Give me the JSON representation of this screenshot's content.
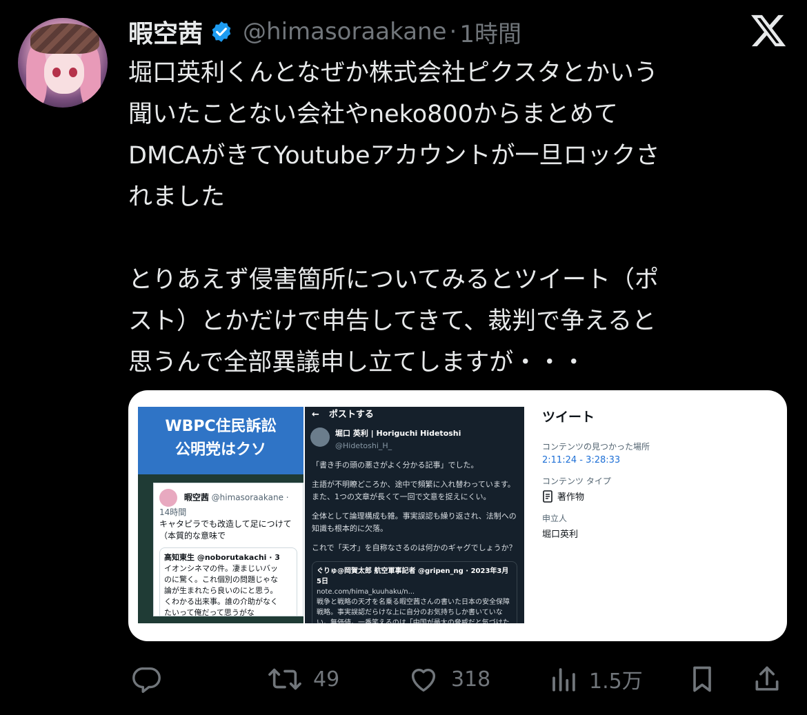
{
  "post": {
    "display_name": "暇空茜",
    "handle": "@himasoraakane",
    "separator": "·",
    "time": "1時間",
    "text": "堀口英利くんとなぜか株式会社ピクスタとかいう\n聞いたことない会社やneko800からまとめて\nDMCAがきてYoutubeアカウントが一旦ロックさ\nれました\n\nとりあえず侵害箇所についてみるとツイート（ポ\nスト）とかだけで申告してきて、裁判で争えると\n思うんで全部異議申し立てしますが・・・"
  },
  "card": {
    "screenshot_left": {
      "banner": "WBPC住民訴訟\n公明党はクソ",
      "tweet_name": "暇空茜",
      "tweet_handle": "@himasoraakane · 14時間",
      "tweet_text": "キャタピラでも改造して足につけて\n（本質的な意味で",
      "quote_author": "高知東生 @noborutakachi · 3",
      "quote_text": "イオンシネマの件。凄まじいバッ\nのに驚く。これ個別の問題じゃな\n論が生まれたら良いのにと思う。\nくわかる出来事。誰の介助がなく\nたいって俺だって思うがな"
    },
    "screenshot_right": {
      "header": "ポストする",
      "author": "堀口 英利 | Horiguchi Hidetoshi",
      "author_handle": "@Hidetoshi_H_",
      "para1": "「書き手の頭の悪さがよく分かる記事」でした。",
      "para2": "主語が不明瞭どころか、途中で頻繁に入れ替わっています。また、1つの文章が長くて一回で文意を捉えにくい。",
      "para3": "全体として論理構成も雑。事実誤認も繰り返され、法制への知識も根本的に欠落。",
      "para4": "これで「天才」を自称なさるのは何かのギャグでしょうか？",
      "quote_author": "ぐりゅ@岡賀太郎 航空軍事記者 @gripen_ng · 2023年3月5日",
      "quote_link": "note.com/hima_kuuhaku/n...",
      "quote_text": "戦争と戦略の天才を名乗る暇空茜さんの書いた日本の安全保障戦略。事実誤認だらけな上に自分のお気持ちしか書いていない。無価値。一番笑えるのは「中国が最大の脅威だと気づけた自分がさも価値のある発見をしたと思っている」こと。このレベルで素野..."
    },
    "meta": {
      "title": "ツイート",
      "found_label": "コンテンツの見つかった場所",
      "found_value": "2:11:24 - 3:28:33",
      "type_label": "コンテンツ タイプ",
      "type_value": "著作物",
      "claimant_label": "申立人",
      "claimant_value": "堀口英利"
    }
  },
  "actions": {
    "reply_count": "",
    "repost_count": "49",
    "like_count": "318",
    "views_count": "1.5万"
  },
  "colors": {
    "background": "#000000",
    "text": "#e7e9ea",
    "muted": "#71767b",
    "verified": "#1d9bf0",
    "link": "#1d6fd6"
  },
  "icons": [
    "verified-badge-icon",
    "x-logo-icon",
    "reply-icon",
    "repost-icon",
    "like-icon",
    "views-icon",
    "bookmark-icon",
    "share-icon"
  ]
}
